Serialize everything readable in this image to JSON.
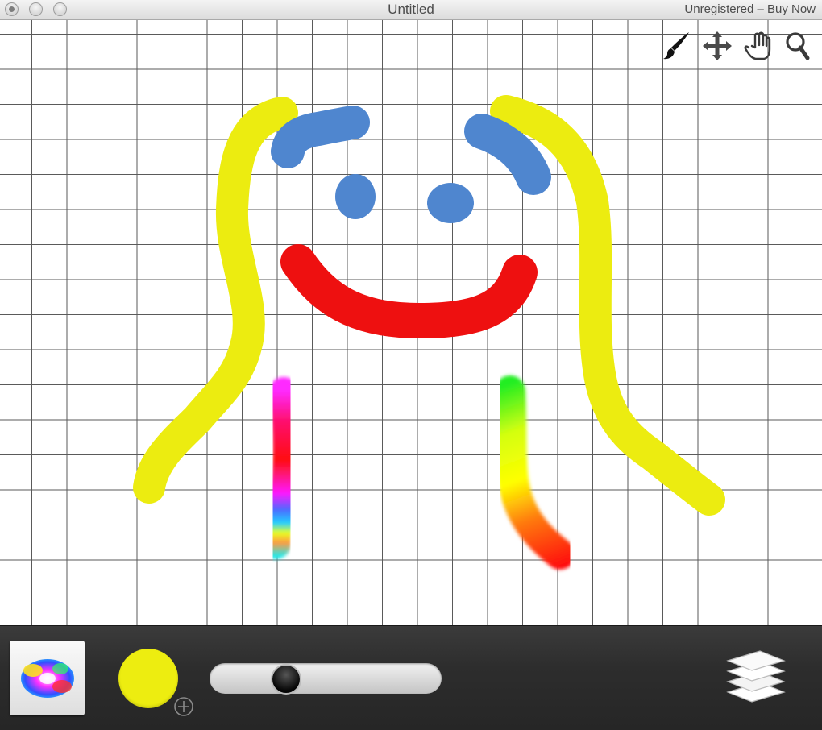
{
  "window": {
    "title": "Untitled",
    "register_link": "Unregistered – Buy Now"
  },
  "tools": [
    {
      "name": "brush-tool",
      "icon": "brush-icon"
    },
    {
      "name": "move-tool",
      "icon": "move-arrows-icon"
    },
    {
      "name": "hand-tool",
      "icon": "hand-icon"
    },
    {
      "name": "zoom-tool",
      "icon": "magnifier-icon"
    }
  ],
  "canvas": {
    "grid": true,
    "stroke_colors": {
      "yellow": "#ecec10",
      "blue": "#4f86cf",
      "red": "#ee1010",
      "rainbow": "gradient",
      "green_yellow_red": "gradient"
    }
  },
  "toolbar": {
    "palette_icon": "color-wheel-icon",
    "current_color": "#eded10",
    "brush_size_fraction": 0.25,
    "add_color_icon": "plus-circle-icon",
    "layers_icon": "layers-icon"
  }
}
